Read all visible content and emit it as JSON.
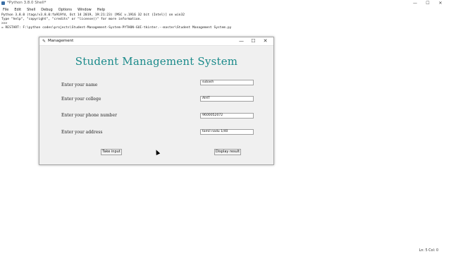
{
  "shell": {
    "title": "*Python 3.8.0 Shell*",
    "controls": {
      "minimize": "—",
      "maximize": "☐",
      "close": "✕"
    },
    "menu": [
      "File",
      "Edit",
      "Shell",
      "Debug",
      "Options",
      "Window",
      "Help"
    ],
    "lines": [
      "Python 3.8.0 (tags/v3.8.0:fa919fd, Oct 14 2019, 19:21:23) [MSC v.1916 32 bit (Intel)] on win32",
      "Type \"help\", \"copyright\", \"credits\" or \"license()\" for more information.",
      ">>>",
      "= RESTART: F:\\python codes\\projects\\Student-Management-System-PYTHON-GUI-tkinter.--master\\Student Management System.py"
    ],
    "status": "Ln: 5   Col: 0"
  },
  "dialog": {
    "title": "Management",
    "controls": {
      "minimize": "—",
      "maximize": "☐",
      "close": "✕"
    },
    "heading": "Student Management System",
    "fields": [
      {
        "label": "Enter your name",
        "value": "subash"
      },
      {
        "label": "Enter your college",
        "value": "AIHT"
      },
      {
        "label": "Enter your phone number",
        "value": "9600052072"
      },
      {
        "label": "Enter your address",
        "value": "tamil nadu 1/40"
      }
    ],
    "buttons": {
      "take_input": "Take input",
      "display_result": "Display result"
    }
  }
}
